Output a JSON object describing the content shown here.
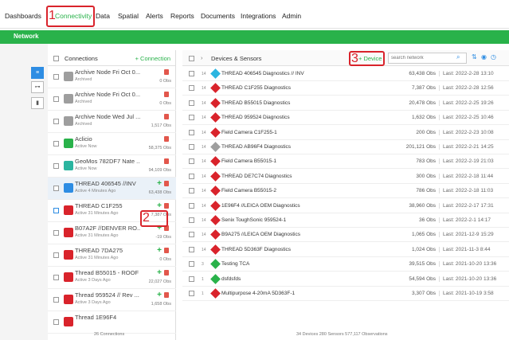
{
  "nav": {
    "items": [
      "Dashboards",
      "Connectivity",
      "Data",
      "Spatial",
      "Alerts",
      "Reports",
      "Documents",
      "Integrations",
      "Admin"
    ],
    "active": "Connectivity"
  },
  "annotations": {
    "one": "1",
    "two": "2",
    "three": "3"
  },
  "subnav": {
    "label": "Network"
  },
  "connections": {
    "header": "Connections",
    "add_label": "+ Connection",
    "footer": "26 Connections",
    "items": [
      {
        "name": "Archive Node Fri Oct 0...",
        "sub": "Archived",
        "obs": "0 Obs",
        "icon": "archive-icon",
        "color": "#9e9e9e"
      },
      {
        "name": "Archive Node Fri Oct 0...",
        "sub": "Archived",
        "obs": "0 Obs",
        "icon": "archive-icon",
        "color": "#9e9e9e"
      },
      {
        "name": "Archive Node Wed Jul ...",
        "sub": "Archived",
        "obs": "1,517 Obs",
        "icon": "archive-icon",
        "color": "#9e9e9e"
      },
      {
        "name": "Aclicio",
        "sub": "Active Now",
        "obs": "58,375 Obs",
        "icon": "globe-icon",
        "color": "#29b24a"
      },
      {
        "name": "GeoMos 782DF7 Nate ...",
        "sub": "Active Now",
        "obs": "94,109 Obs",
        "icon": "database-icon",
        "color": "#2bb5a0"
      },
      {
        "name": "THREAD 406545 //INV",
        "sub": "Active 4 Minutes Ago",
        "obs": "63,438 Obs",
        "icon": "thread-device-icon",
        "color": "#2e8de3"
      },
      {
        "name": "THREAD C1F255",
        "sub": "Active 31 Minutes Ago",
        "obs": "7,387 Obs",
        "icon": "thread-device-icon",
        "color": "#d9232b"
      },
      {
        "name": "B07A2F //DENVER RO...",
        "sub": "Active 31 Minutes Ago",
        "obs": "-19 Obs",
        "icon": "thread-device-icon",
        "color": "#d9232b"
      },
      {
        "name": "THREAD 7DA275",
        "sub": "Active 31 Minutes Ago",
        "obs": "0 Obs",
        "icon": "thread-device-icon",
        "color": "#d9232b"
      },
      {
        "name": "Thread B55015 - ROOF",
        "sub": "Active 3 Days Ago",
        "obs": "22,027 Obs",
        "icon": "thread-device-icon",
        "color": "#d9232b"
      },
      {
        "name": "Thread 959524 // Rev ...",
        "sub": "Active 3 Days Ago",
        "obs": "1,658 Obs",
        "icon": "thread-device-icon",
        "color": "#d9232b"
      },
      {
        "name": "Thread 1E96F4",
        "sub": "",
        "obs": "",
        "icon": "thread-device-icon",
        "color": "#d9232b"
      }
    ]
  },
  "devices": {
    "header": "Devices & Sensors",
    "add_label": "+ Device",
    "search_placeholder": "search network",
    "footer": "34 Devices   280 Sensors   577,117 Observations",
    "items": [
      {
        "count": "14",
        "name": "THREAD 406545 Diagnostics // INV",
        "obs": "63,438 Obs",
        "last": "Last: 2022-2-28 13:10",
        "color": "#2bb5e0"
      },
      {
        "count": "14",
        "name": "THREAD C1F255 Diagnostics",
        "obs": "7,387 Obs",
        "last": "Last: 2022-2-28 12:56",
        "color": "#d9232b"
      },
      {
        "count": "14",
        "name": "THREAD B55015 Diagnostics",
        "obs": "20,478 Obs",
        "last": "Last: 2022-2-25 19:26",
        "color": "#d9232b"
      },
      {
        "count": "14",
        "name": "THREAD 959524 Diagnostics",
        "obs": "1,632 Obs",
        "last": "Last: 2022-2-25 10:46",
        "color": "#d9232b"
      },
      {
        "count": "14",
        "name": "Field Camera C1F255-1",
        "obs": "200 Obs",
        "last": "Last: 2022-2-23 10:08",
        "color": "#d9232b"
      },
      {
        "count": "14",
        "name": "THREAD AB96F4 Diagnostics",
        "obs": "201,121 Obs",
        "last": "Last: 2022-2-21 14:25",
        "color": "#9e9e9e"
      },
      {
        "count": "14",
        "name": "Field Camera B55015-1",
        "obs": "783 Obs",
        "last": "Last: 2022-2-19 21:03",
        "color": "#d9232b"
      },
      {
        "count": "14",
        "name": "THREAD DE7C74 Diagnostics",
        "obs": "300 Obs",
        "last": "Last: 2022-2-18 11:44",
        "color": "#d9232b"
      },
      {
        "count": "14",
        "name": "Field Camera B55015-2",
        "obs": "786 Obs",
        "last": "Last: 2022-2-18 11:03",
        "color": "#d9232b"
      },
      {
        "count": "14",
        "name": "1E96F4 //LEICA OEM Diagnostics",
        "obs": "38,960 Obs",
        "last": "Last: 2022-2-17 17:31",
        "color": "#d9232b"
      },
      {
        "count": "14",
        "name": "Senix ToughSonic 959524-1",
        "obs": "36 Obs",
        "last": "Last: 2022-2-1 14:17",
        "color": "#d9232b"
      },
      {
        "count": "14",
        "name": "B9A275 //LEICA OEM Diagnostics",
        "obs": "1,065 Obs",
        "last": "Last: 2021-12-9 15:29",
        "color": "#d9232b"
      },
      {
        "count": "14",
        "name": "THREAD 5D363F Diagnostics",
        "obs": "1,024 Obs",
        "last": "Last: 2021-11-3 8:44",
        "color": "#d9232b"
      },
      {
        "count": "3",
        "name": "Testing TCA",
        "obs": "39,515 Obs",
        "last": "Last: 2021-10-20 13:36",
        "color": "#29b24a"
      },
      {
        "count": "1",
        "name": "dsfdsfds",
        "obs": "54,594 Obs",
        "last": "Last: 2021-10-20 13:36",
        "color": "#29b24a"
      },
      {
        "count": "1",
        "name": "Multipurpose 4-20mA 5D363F-1",
        "obs": "3,307 Obs",
        "last": "Last: 2021-10-19 3:58",
        "color": "#d9232b"
      }
    ]
  }
}
